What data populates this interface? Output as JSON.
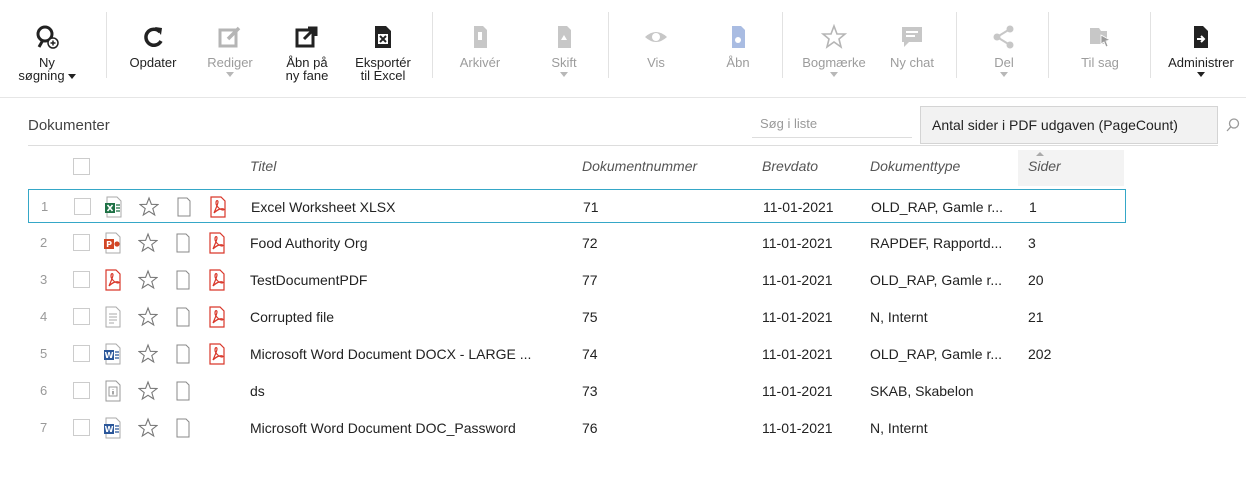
{
  "toolbar": {
    "items": [
      {
        "id": "ny-sogning",
        "label": "Ny\nsøgning",
        "icon": "search-plus-icon",
        "caret": "inline",
        "disabled": false
      },
      {
        "id": "opdater",
        "label": "Opdater",
        "icon": "refresh-icon",
        "disabled": false
      },
      {
        "id": "rediger",
        "label": "Rediger",
        "icon": "edit-icon",
        "caret": "below",
        "disabled": true
      },
      {
        "id": "abn-pa-ny-fane",
        "label": "Åbn på\nny fane",
        "icon": "open-new-tab-icon",
        "disabled": false
      },
      {
        "id": "eksporter-excel",
        "label": "Eksportér\ntil Excel",
        "icon": "excel-export-icon",
        "disabled": false
      },
      {
        "id": "arkiver",
        "label": "Arkivér",
        "icon": "archive-icon",
        "disabled": true
      },
      {
        "id": "skift",
        "label": "Skift",
        "icon": "switch-icon",
        "caret": "below",
        "disabled": true
      },
      {
        "id": "vis",
        "label": "Vis",
        "icon": "eye-icon",
        "disabled": true
      },
      {
        "id": "abn",
        "label": "Åbn",
        "icon": "open-document-icon",
        "disabled": true
      },
      {
        "id": "bogmaerke",
        "label": "Bogmærke",
        "icon": "star-icon",
        "caret": "below",
        "disabled": true
      },
      {
        "id": "ny-chat",
        "label": "Ny chat",
        "icon": "chat-icon",
        "disabled": true
      },
      {
        "id": "del",
        "label": "Del",
        "icon": "share-icon",
        "caret": "below",
        "disabled": true
      },
      {
        "id": "til-sag",
        "label": "Til sag",
        "icon": "move-to-case-icon",
        "disabled": true
      },
      {
        "id": "administrer",
        "label": "Administrer",
        "icon": "manage-icon",
        "caret": "below",
        "disabled": false
      }
    ]
  },
  "list": {
    "title": "Dokumenter",
    "search_placeholder": "Søg i liste",
    "tooltip": "Antal sider i PDF udgaven (PageCount)"
  },
  "columns": {
    "title": "Titel",
    "number": "Dokumentnummer",
    "date": "Brevdato",
    "type": "Dokumenttype",
    "pages": "Sider"
  },
  "colors": {
    "accent": "#35a7c7",
    "excel": "#1e7145",
    "word": "#2b579a",
    "powerpoint": "#d24726",
    "pdf": "#d9372a"
  },
  "rows": [
    {
      "num": "1",
      "icon": "excel-file-icon",
      "title": "Excel Worksheet XLSX",
      "number": "71",
      "date": "11-01-2021",
      "type": "OLD_RAP, Gamle r...",
      "pages": "1",
      "pdf": true,
      "selected": true
    },
    {
      "num": "2",
      "icon": "powerpoint-file-icon",
      "title": "Food Authority Org",
      "number": "72",
      "date": "11-01-2021",
      "type": "RAPDEF, Rapportd...",
      "pages": "3",
      "pdf": true,
      "selected": false
    },
    {
      "num": "3",
      "icon": "pdf-file-icon",
      "title": "TestDocumentPDF",
      "number": "77",
      "date": "11-01-2021",
      "type": "OLD_RAP, Gamle r...",
      "pages": "20",
      "pdf": true,
      "selected": false
    },
    {
      "num": "4",
      "icon": "text-file-icon",
      "title": "Corrupted file",
      "number": "75",
      "date": "11-01-2021",
      "type": "N, Internt",
      "pages": "21",
      "pdf": true,
      "selected": false
    },
    {
      "num": "5",
      "icon": "word-file-icon",
      "title": "Microsoft Word Document DOCX - LARGE ...",
      "number": "74",
      "date": "11-01-2021",
      "type": "OLD_RAP, Gamle r...",
      "pages": "202",
      "pdf": true,
      "selected": false
    },
    {
      "num": "6",
      "icon": "info-file-icon",
      "title": "ds",
      "number": "73",
      "date": "11-01-2021",
      "type": "SKAB, Skabelon",
      "pages": "",
      "pdf": false,
      "selected": false
    },
    {
      "num": "7",
      "icon": "word-file-icon",
      "title": "Microsoft Word Document DOC_Password",
      "number": "76",
      "date": "11-01-2021",
      "type": "N, Internt",
      "pages": "",
      "pdf": false,
      "selected": false
    }
  ]
}
